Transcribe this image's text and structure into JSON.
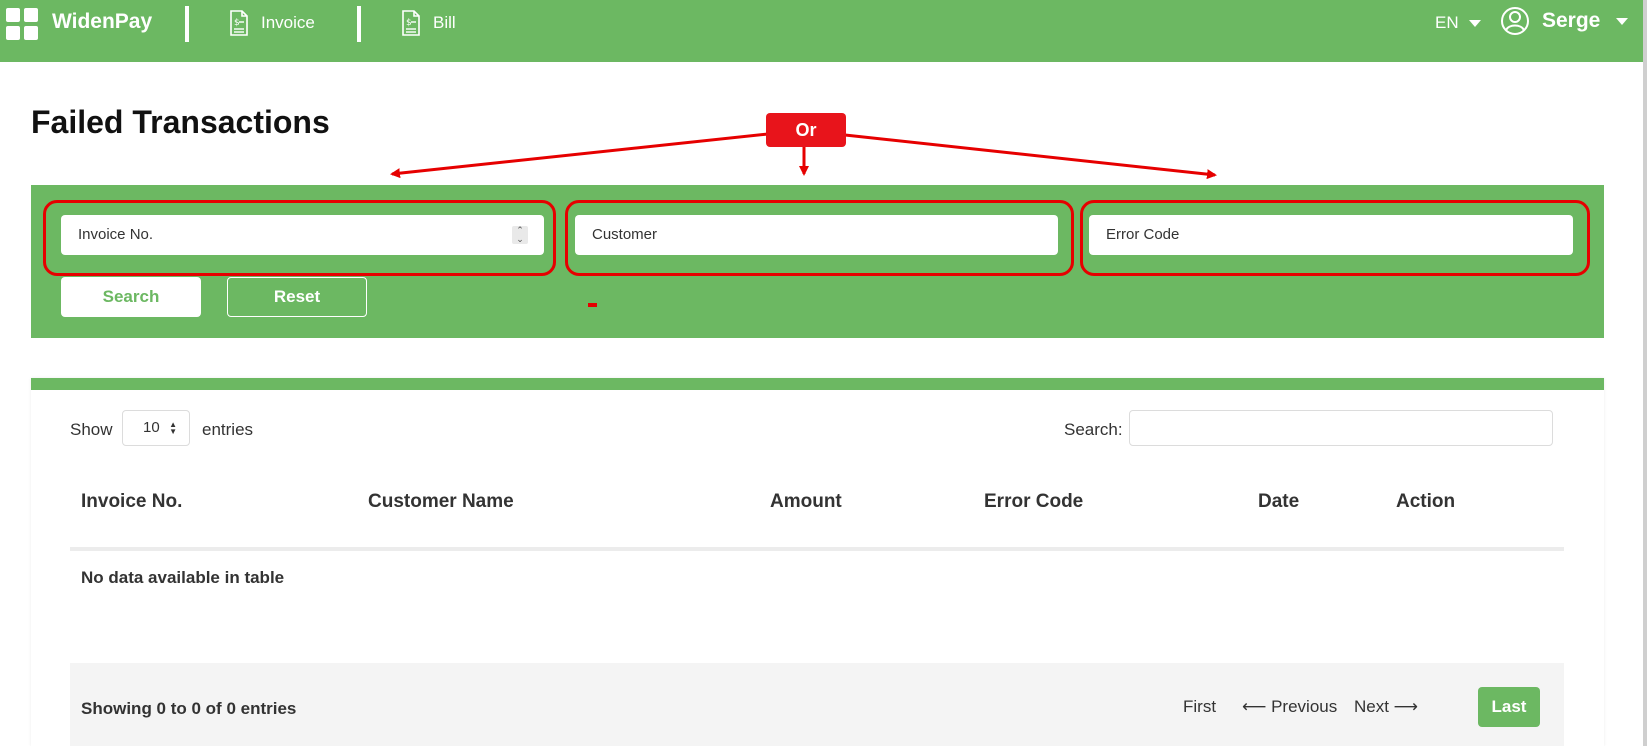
{
  "header": {
    "brand": "WidenPay",
    "nav": [
      {
        "label": "Invoice",
        "icon": "invoice-icon"
      },
      {
        "label": "Bill",
        "icon": "bill-icon"
      }
    ],
    "language": "EN",
    "user_name": "Serge"
  },
  "page": {
    "title": "Failed Transactions"
  },
  "filters": {
    "invoice_placeholder": "Invoice No.",
    "customer_placeholder": "Customer",
    "error_code_placeholder": "Error Code",
    "search_label": "Search",
    "reset_label": "Reset"
  },
  "annotation": {
    "label": "Or",
    "color": "#e60000"
  },
  "table": {
    "show_label": "Show",
    "page_length": "10",
    "entries_label": "entries",
    "search_label": "Search:",
    "columns": [
      "Invoice No.",
      "Customer Name",
      "Amount",
      "Error Code",
      "Date",
      "Action"
    ],
    "empty_message": "No data available in table",
    "info": "Showing 0 to 0 of 0 entries",
    "pagination": {
      "first": "First",
      "previous": "⟵ Previous",
      "next": "Next ⟶",
      "last": "Last"
    }
  },
  "colors": {
    "brand_green": "#6cb862",
    "annotation_red": "#e60000"
  }
}
